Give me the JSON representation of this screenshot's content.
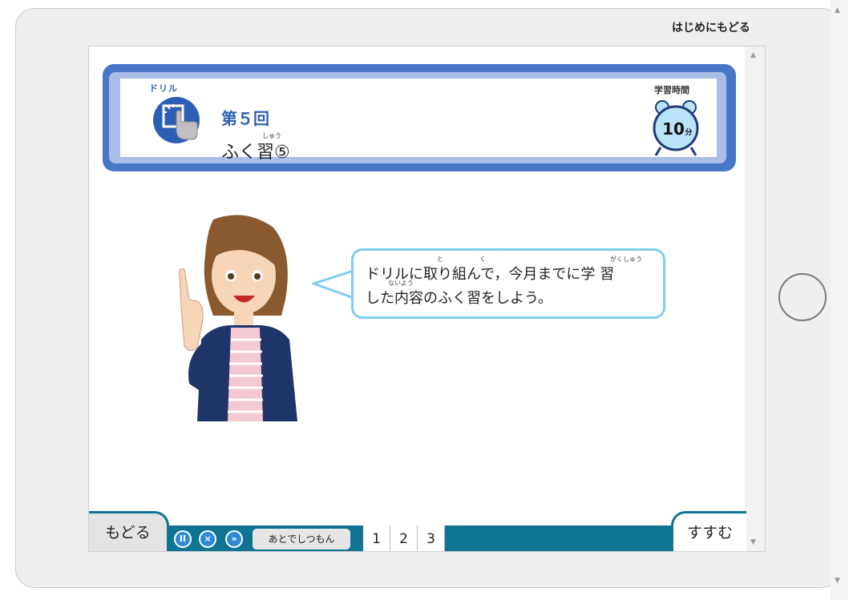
{
  "top_link": "はじめにもどる",
  "header": {
    "drill_label": "ドリル",
    "round": "第５回",
    "title": "ふく習⑤",
    "title_ruby": "しゅう",
    "study_time_label": "学習時間",
    "minutes": "10",
    "minutes_unit": "分"
  },
  "speech": {
    "line1": "ドリルに取り組んで，今月までに学 習",
    "line2": "した内容のふく習をしよう。",
    "ruby": {
      "to": "と",
      "ku": "く",
      "gakushu": "がくしゅう",
      "naiyou": "ないよう"
    }
  },
  "footer": {
    "back_label": "もどる",
    "next_label": "すすむ",
    "later_label": "あとでしつもん",
    "pages": [
      "1",
      "2",
      "3"
    ]
  },
  "colors": {
    "header_blue": "#4977c8",
    "footer_teal": "#0f7494",
    "bubble_border": "#7fcdf0",
    "title_blue": "#2c5fb3"
  }
}
